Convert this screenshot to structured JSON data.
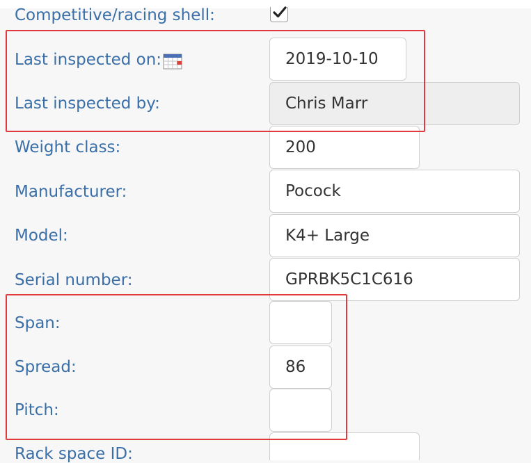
{
  "rows": {
    "competitive": {
      "label": "Competitive/racing shell:",
      "checked": true
    },
    "last_inspected_on": {
      "label": "Last inspected on:",
      "value": "2019-10-10"
    },
    "last_inspected_by": {
      "label": "Last inspected by:",
      "value": "Chris Marr"
    },
    "weight_class": {
      "label": "Weight class:",
      "value": "200"
    },
    "manufacturer": {
      "label": "Manufacturer:",
      "value": "Pocock"
    },
    "model": {
      "label": "Model:",
      "value": "K4+ Large"
    },
    "serial_number": {
      "label": "Serial number:",
      "value": "GPRBK5C1C616"
    },
    "span": {
      "label": "Span:",
      "value": ""
    },
    "spread": {
      "label": "Spread:",
      "value": "86"
    },
    "pitch": {
      "label": "Pitch:",
      "value": ""
    },
    "rack_space_id": {
      "label": "Rack space ID:",
      "value": ""
    }
  },
  "colors": {
    "label": "#3a6fa8",
    "highlight": "#e0393e",
    "field_border": "#cfcfcf",
    "readonly_bg": "#eeeeee"
  },
  "icons": {
    "checkbox": "checkmark-icon",
    "date_picker": "calendar-icon"
  }
}
